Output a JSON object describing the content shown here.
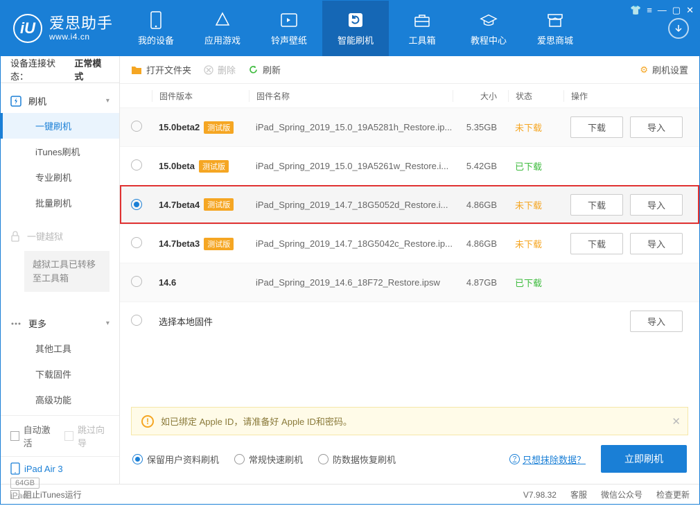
{
  "app": {
    "name_cn": "爱思助手",
    "name_en": "www.i4.cn"
  },
  "nav": [
    {
      "label": "我的设备"
    },
    {
      "label": "应用游戏"
    },
    {
      "label": "铃声壁纸"
    },
    {
      "label": "智能刷机"
    },
    {
      "label": "工具箱"
    },
    {
      "label": "教程中心"
    },
    {
      "label": "爱思商城"
    }
  ],
  "conn": {
    "label": "设备连接状态：",
    "value": "正常模式"
  },
  "sidebar": {
    "sec1": {
      "head": "刷机",
      "items": [
        "一键刷机",
        "iTunes刷机",
        "专业刷机",
        "批量刷机"
      ]
    },
    "sec2": {
      "head": "一键越狱",
      "note": "越狱工具已转移至工具箱"
    },
    "sec3": {
      "head": "更多",
      "items": [
        "其他工具",
        "下载固件",
        "高级功能"
      ]
    },
    "checks": {
      "auto": "自动激活",
      "skip": "跳过向导"
    },
    "device": {
      "name": "iPad Air 3",
      "storage": "64GB",
      "type": "iPad"
    }
  },
  "toolbar": {
    "open": "打开文件夹",
    "delete": "删除",
    "refresh": "刷新",
    "settings": "刷机设置"
  },
  "columns": {
    "version": "固件版本",
    "name": "固件名称",
    "size": "大小",
    "status": "状态",
    "ops": "操作"
  },
  "badge": "测试版",
  "btn_download": "下载",
  "btn_import": "导入",
  "select_local": "选择本地固件",
  "status_not": "未下载",
  "status_done": "已下载",
  "rows": [
    {
      "ver": "15.0beta2",
      "badge": true,
      "name": "iPad_Spring_2019_15.0_19A5281h_Restore.ip...",
      "size": "5.35GB",
      "status": "not",
      "dl": true,
      "imp": true,
      "sel": false
    },
    {
      "ver": "15.0beta",
      "badge": true,
      "name": "iPad_Spring_2019_15.0_19A5261w_Restore.i...",
      "size": "5.42GB",
      "status": "done",
      "dl": false,
      "imp": false,
      "sel": false
    },
    {
      "ver": "14.7beta4",
      "badge": true,
      "name": "iPad_Spring_2019_14.7_18G5052d_Restore.i...",
      "size": "4.86GB",
      "status": "not",
      "dl": true,
      "imp": true,
      "sel": true,
      "highlight": true
    },
    {
      "ver": "14.7beta3",
      "badge": true,
      "name": "iPad_Spring_2019_14.7_18G5042c_Restore.ip...",
      "size": "4.86GB",
      "status": "not",
      "dl": true,
      "imp": true,
      "sel": false
    },
    {
      "ver": "14.6",
      "badge": false,
      "name": "iPad_Spring_2019_14.6_18F72_Restore.ipsw",
      "size": "4.87GB",
      "status": "done",
      "dl": false,
      "imp": false,
      "sel": false
    }
  ],
  "notice": "如已绑定 Apple ID，请准备好 Apple ID和密码。",
  "options": {
    "opt1": "保留用户资料刷机",
    "opt2": "常规快速刷机",
    "opt3": "防数据恢复刷机",
    "link": "只想抹除数据？",
    "action": "立即刷机"
  },
  "statusbar": {
    "block": "阻止iTunes运行",
    "version": "V7.98.32",
    "service": "客服",
    "wechat": "微信公众号",
    "update": "检查更新"
  }
}
